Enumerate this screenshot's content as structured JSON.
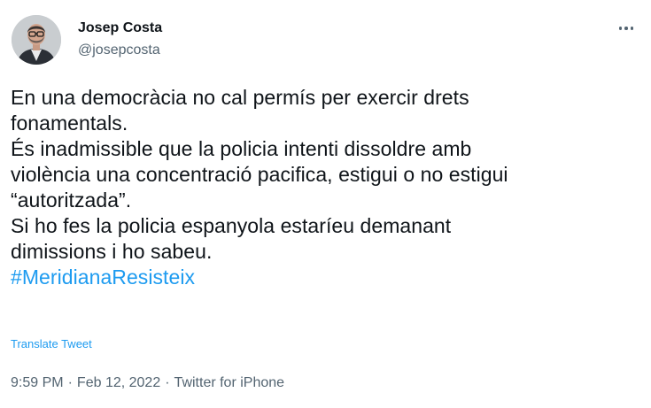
{
  "author": {
    "display_name": "Josep Costa",
    "handle": "@josepcosta",
    "avatar_icon": "profile-photo"
  },
  "more_icon": "more-horizontal-icon",
  "tweet": {
    "lines": [
      "En una democràcia no cal permís per exercir drets",
      "fonamentals.",
      "És inadmissible que la policia intenti dissoldre amb",
      "violència una concentració pacifica, estigui o no estigui",
      "“autoritzada”.",
      "Si ho fes la policia espanyola estaríeu demanant",
      "dimissions i ho sabeu."
    ],
    "hashtag": "#MeridianaResisteix",
    "translate_label": "Translate Tweet"
  },
  "meta": {
    "time": "9:59 PM",
    "separator": "·",
    "date": "Feb 12, 2022",
    "source": "Twitter for iPhone"
  },
  "colors": {
    "link": "#1d9bf0",
    "secondary_text": "#536471",
    "primary_text": "#0f1419"
  }
}
